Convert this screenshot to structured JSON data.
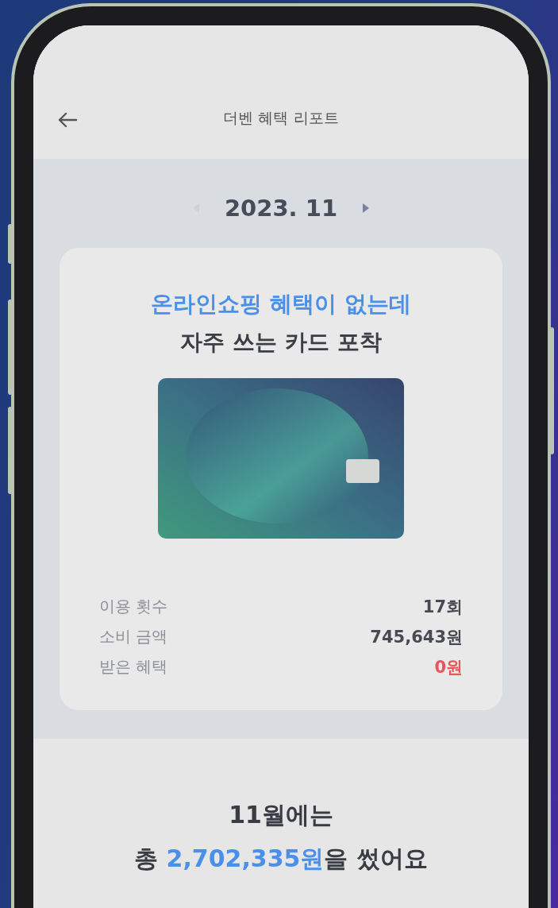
{
  "header": {
    "title": "더벤 혜택 리포트"
  },
  "month_nav": {
    "label": "2023. 11",
    "prev_disabled": true,
    "next_disabled": false
  },
  "card": {
    "headline_highlight": "온라인쇼핑 혜택이 없는데",
    "headline": "자주 쓰는 카드 포착",
    "stats": [
      {
        "label": "이용 횟수",
        "value": "17회",
        "emphasis": false
      },
      {
        "label": "소비 금액",
        "value": "745,643원",
        "emphasis": false
      },
      {
        "label": "받은 혜택",
        "value": "0원",
        "emphasis": true
      }
    ]
  },
  "summary": {
    "line_1": "11월에는",
    "prefix": "총 ",
    "amount": "2,702,335원",
    "suffix": "을 썼어요"
  }
}
